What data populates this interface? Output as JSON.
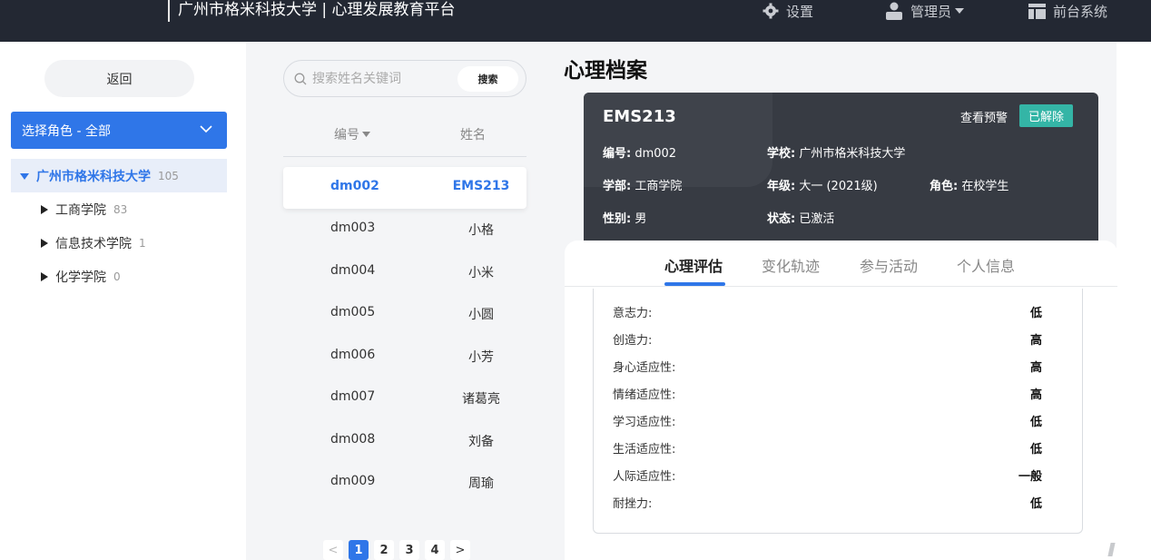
{
  "header": {
    "title": "广州市格米科技大学 | 心理发展教育平台",
    "settings_label": "设置",
    "admin_label": "管理员",
    "front_label": "前台系统"
  },
  "sidebar": {
    "back_label": "返回",
    "role_select": "选择角色 - 全部",
    "tree_root": {
      "label": "广州市格米科技大学",
      "count": "105"
    },
    "tree_children": [
      {
        "label": "工商学院",
        "count": "83"
      },
      {
        "label": "信息技术学院",
        "count": "1"
      },
      {
        "label": "化学学院",
        "count": "0"
      }
    ]
  },
  "list": {
    "search_placeholder": "搜索姓名关键词",
    "search_button": "搜索",
    "col_id": "编号",
    "col_name": "姓名",
    "rows": [
      {
        "id": "dm002",
        "name": "EMS213"
      },
      {
        "id": "dm003",
        "name": "小格"
      },
      {
        "id": "dm004",
        "name": "小米"
      },
      {
        "id": "dm005",
        "name": "小圆"
      },
      {
        "id": "dm006",
        "name": "小芳"
      },
      {
        "id": "dm007",
        "name": "诸葛亮"
      },
      {
        "id": "dm008",
        "name": "刘备"
      },
      {
        "id": "dm009",
        "name": "周瑜"
      }
    ],
    "pagination": {
      "prev": "<",
      "next": ">",
      "pages": [
        "1",
        "2",
        "3",
        "4"
      ],
      "current": "1"
    }
  },
  "profile": {
    "page_title": "心理档案",
    "name": "EMS213",
    "warning_link": "查看预警",
    "status_badge": "已解除",
    "fields": {
      "id_label": "编号:",
      "id_value": "dm002",
      "school_label": "学校:",
      "school_value": "广州市格米科技大学",
      "dept_label": "学部:",
      "dept_value": "工商学院",
      "grade_label": "年级:",
      "grade_value": "大一 (2021级)",
      "role_label": "角色:",
      "role_value": "在校学生",
      "gender_label": "性别:",
      "gender_value": "男",
      "state_label": "状态:",
      "state_value": "已激活"
    },
    "tabs": [
      "心理评估",
      "变化轨迹",
      "参与活动",
      "个人信息"
    ],
    "active_tab": "心理评估",
    "evaluation": [
      {
        "label": "意志力:",
        "value": "低"
      },
      {
        "label": "创造力:",
        "value": "高"
      },
      {
        "label": "身心适应性:",
        "value": "高"
      },
      {
        "label": "情绪适应性:",
        "value": "高"
      },
      {
        "label": "学习适应性:",
        "value": "低"
      },
      {
        "label": "生活适应性:",
        "value": "低"
      },
      {
        "label": "人际适应性:",
        "value": "一般"
      },
      {
        "label": "耐挫力:",
        "value": "低"
      }
    ]
  },
  "colors": {
    "topbar": "#232833",
    "accent": "#2f76e8",
    "card_bg": "#373b43",
    "badge": "#34b5a6"
  }
}
